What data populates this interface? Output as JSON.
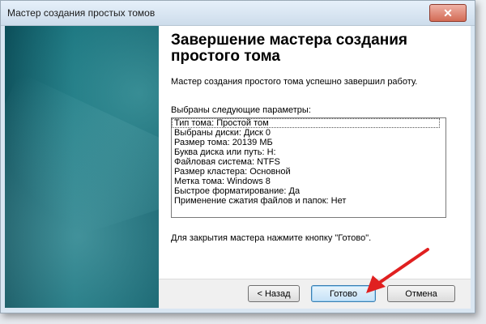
{
  "window": {
    "title": "Мастер создания простых томов",
    "close_glyph": "✕"
  },
  "main": {
    "heading": "Завершение мастера создания простого тома",
    "description": "Мастер создания простого тома успешно завершил работу.",
    "params_label": "Выбраны следующие параметры:",
    "params": [
      "Тип тома: Простой том",
      "Выбраны диски: Диск 0",
      "Размер тома: 20139 МБ",
      "Буква диска или путь: H:",
      "Файловая система: NTFS",
      "Размер кластера: Основной",
      "Метка тома: Windows 8",
      "Быстрое форматирование: Да",
      "Применение сжатия файлов и папок: Нет"
    ],
    "footer": "Для закрытия мастера нажмите кнопку \"Готово\"."
  },
  "buttons": {
    "back": "< Назад",
    "finish": "Готово",
    "cancel": "Отмена"
  },
  "colors": {
    "accent_teal": "#0f6a75",
    "arrow_red": "#e02020"
  },
  "icons": {
    "close": "close-icon",
    "annotation": "red-arrow-icon"
  }
}
